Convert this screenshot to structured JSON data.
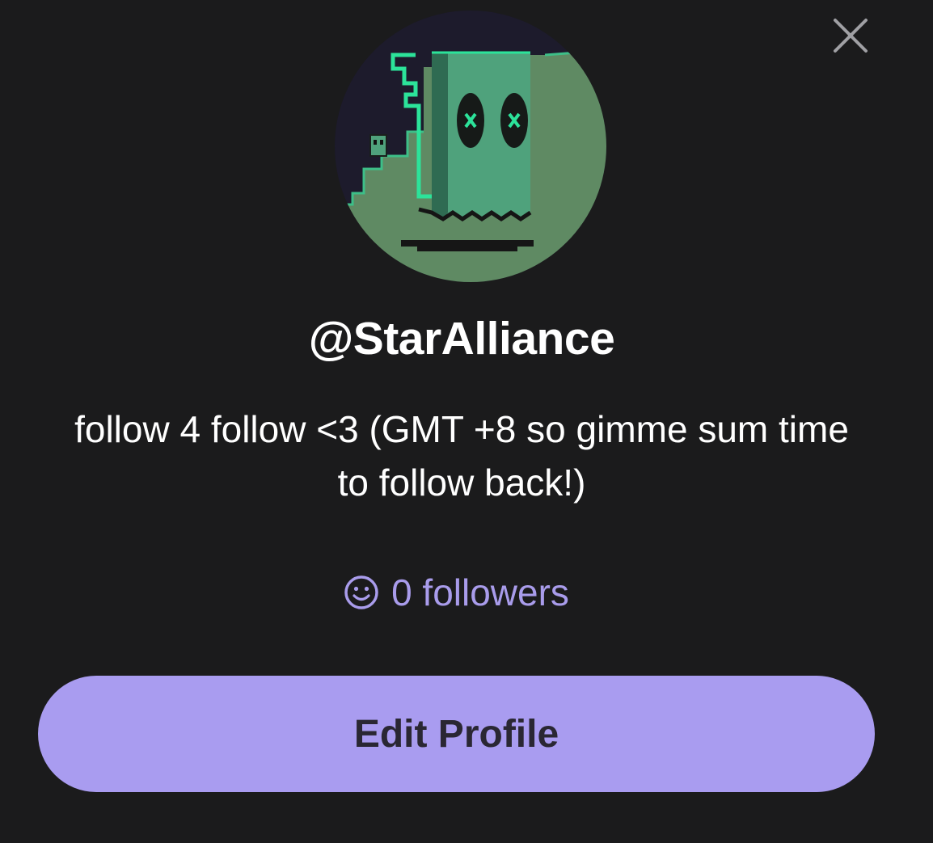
{
  "profile": {
    "username": "@StarAlliance",
    "bio": "follow 4 follow <3 (GMT +8 so gimme sum time to follow back!)",
    "followers_text": "0 followers"
  },
  "actions": {
    "edit_label": "Edit Profile"
  },
  "icons": {
    "close": "close-icon",
    "followers": "smiley-icon"
  },
  "colors": {
    "background": "#1b1b1c",
    "accent": "#a99cf0",
    "accent_text": "#a99ceb",
    "avatar_green": "#4fa27c",
    "avatar_outline": "#2ce39a"
  }
}
